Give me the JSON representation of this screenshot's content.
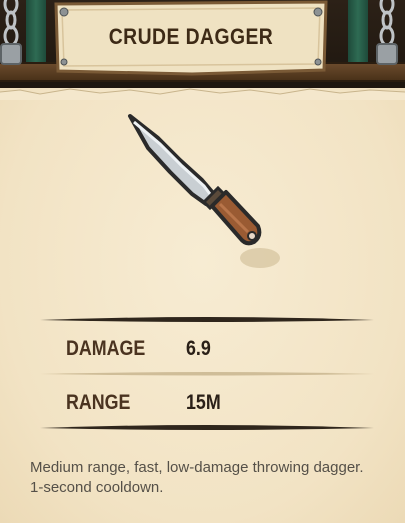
{
  "item": {
    "title": "CRUDE DAGGER",
    "icon": "dagger-icon",
    "description": "Medium range, fast, low-damage throwing dagger. 1-second cooldown."
  },
  "stats": [
    {
      "label": "DAMAGE",
      "value": "6.9"
    },
    {
      "label": "RANGE",
      "value": "15M"
    }
  ],
  "colors": {
    "parchment": "#f4e7cc",
    "title_text": "#3d2a16",
    "stat_label": "#4a3320",
    "stat_value": "#2a2018",
    "description_text": "#555048",
    "wood": "#5a3e24"
  }
}
